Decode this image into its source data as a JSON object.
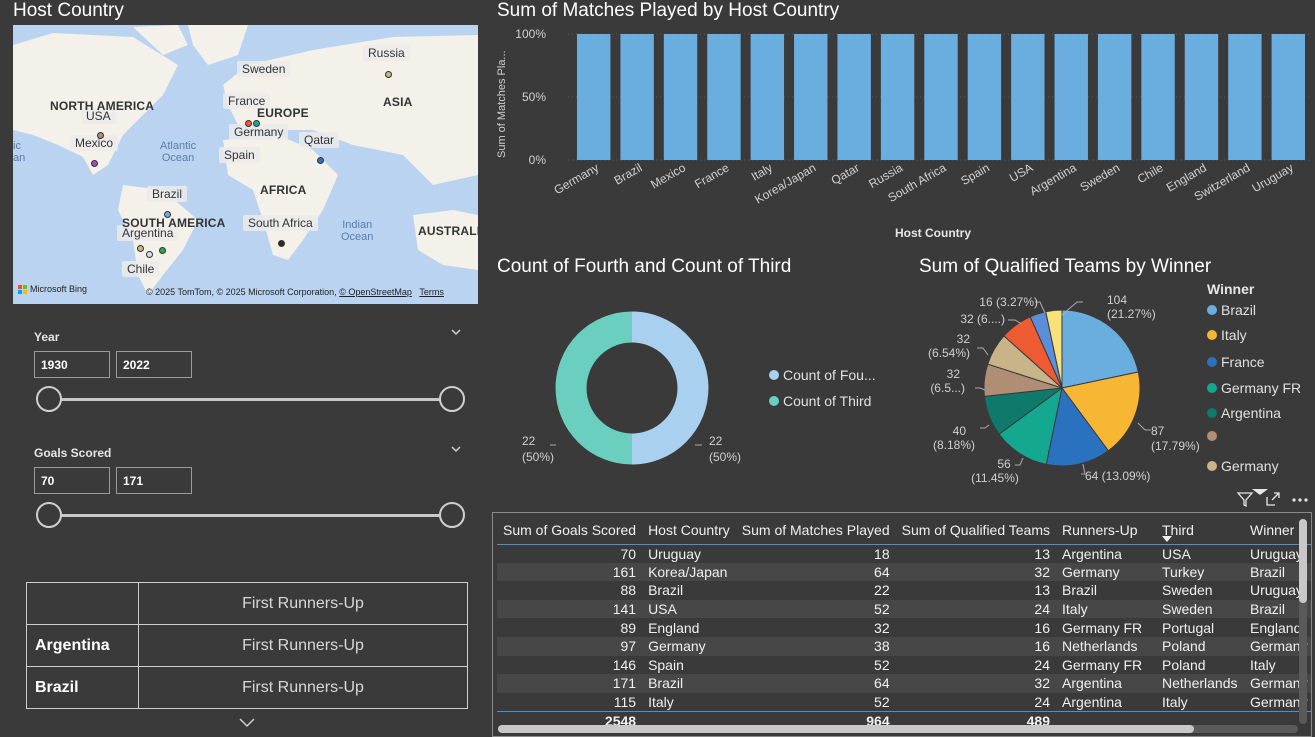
{
  "map": {
    "title": "Host Country",
    "countries": [
      "Sweden",
      "Russia",
      "France",
      "USA",
      "Germany",
      "Mexico",
      "Qatar",
      "Spain",
      "Brazil",
      "Argentina",
      "South Africa",
      "Chile"
    ],
    "regions": [
      "NORTH AMERICA",
      "EUROPE",
      "ASIA",
      "AFRICA",
      "SOUTH AMERICA",
      "AUSTRALIA"
    ],
    "oceans": [
      "Atlantic\nOcean",
      "Indian\nOcean"
    ],
    "fragment": "ic\nan",
    "bing": "Microsoft Bing",
    "credit": "© 2025 TomTom, © 2025 Microsoft Corporation,",
    "osm": "© OpenStreetMap",
    "terms": "Terms"
  },
  "year_slicer": {
    "title": "Year",
    "min": "1930",
    "max": "2022"
  },
  "goals_slicer": {
    "title": "Goals Scored",
    "min": "70",
    "max": "171"
  },
  "runners": {
    "header_value": "First Runners-Up",
    "rows": [
      {
        "name": "Argentina",
        "value": "First Runners-Up"
      },
      {
        "name": "Brazil",
        "value": "First Runners-Up"
      }
    ]
  },
  "chart_data": [
    {
      "type": "bar",
      "title": "Sum of Matches Played by Host Country",
      "xlabel": "Host Country",
      "ylabel": "Sum of Matches Pla...",
      "categories": [
        "Germany",
        "Brazil",
        "Mexico",
        "France",
        "Italy",
        "Korea/Japan",
        "Qatar",
        "Russia",
        "South Africa",
        "Spain",
        "USA",
        "Argentina",
        "Sweden",
        "Chile",
        "England",
        "Switzerland",
        "Uruguay"
      ],
      "values": [
        100,
        100,
        100,
        100,
        100,
        100,
        100,
        100,
        100,
        100,
        100,
        100,
        100,
        100,
        100,
        100,
        100
      ],
      "yticks": [
        "100%",
        "50%",
        "0%"
      ],
      "ylim": [
        0,
        100
      ],
      "color": "#6aaee0"
    },
    {
      "type": "pie",
      "title": "Count of Fourth and Count of Third",
      "series": [
        {
          "name": "Count of Fou...",
          "value": 22,
          "label": "22",
          "pct": "(50%)",
          "color": "#a9d0ee"
        },
        {
          "name": "Count of Third",
          "value": 22,
          "label": "22",
          "pct": "(50%)",
          "color": "#6acfbf"
        }
      ]
    },
    {
      "type": "pie",
      "title": "Sum of Qualified Teams by Winner",
      "legend_title": "Winner",
      "legend": [
        {
          "name": "Brazil",
          "color": "#6aaee0"
        },
        {
          "name": "Italy",
          "color": "#f7b734"
        },
        {
          "name": "France",
          "color": "#2a72c0"
        },
        {
          "name": "Germany FR",
          "color": "#14a891"
        },
        {
          "name": "Argentina",
          "color": "#0f7a6c"
        },
        {
          "name": "",
          "color": "#b08e76"
        },
        {
          "name": "Germany",
          "color": "#c8b488"
        }
      ],
      "slices": [
        {
          "value": 104,
          "label": "104",
          "pct": "(21.27%)",
          "color": "#6aaee0"
        },
        {
          "value": 87,
          "label": "87",
          "pct": "(17.79%)",
          "color": "#f7b734"
        },
        {
          "value": 64,
          "label": "64 (13.09%)",
          "pct": "",
          "color": "#2a72c0"
        },
        {
          "value": 56,
          "label": "56",
          "pct": "(11.45%)",
          "color": "#14a891"
        },
        {
          "value": 40,
          "label": "40",
          "pct": "(8.18%)",
          "color": "#0f7a6c"
        },
        {
          "value": 32,
          "label": "32",
          "pct": "(6.5...)",
          "color": "#b08e76"
        },
        {
          "value": 32,
          "label": "32",
          "pct": "(6.54%)",
          "color": "#c8b488"
        },
        {
          "value": 32,
          "label": "32 (6....)",
          "pct": "",
          "color": "#ee5a32"
        },
        {
          "value": 16,
          "label": "16 (3.27%)",
          "pct": "",
          "color": "#5a8ed8"
        },
        {
          "value": 16,
          "label": "",
          "pct": "",
          "color": "#f8e07a"
        }
      ]
    }
  ],
  "grid": {
    "columns": [
      "Sum of Goals Scored",
      "Host Country",
      "Sum of Matches Played",
      "Sum of Qualified Teams",
      "Runners-Up",
      "Third",
      "Winner"
    ],
    "rows": [
      [
        "70",
        "Uruguay",
        "18",
        "13",
        "Argentina",
        "USA",
        "Uruguay"
      ],
      [
        "161",
        "Korea/Japan",
        "64",
        "32",
        "Germany",
        "Turkey",
        "Brazil"
      ],
      [
        "88",
        "Brazil",
        "22",
        "13",
        "Brazil",
        "Sweden",
        "Uruguay"
      ],
      [
        "141",
        "USA",
        "52",
        "24",
        "Italy",
        "Sweden",
        "Brazil"
      ],
      [
        "89",
        "England",
        "32",
        "16",
        "Germany FR",
        "Portugal",
        "England"
      ],
      [
        "97",
        "Germany",
        "38",
        "16",
        "Netherlands",
        "Poland",
        "Germany"
      ],
      [
        "146",
        "Spain",
        "52",
        "24",
        "Germany FR",
        "Poland",
        "Italy"
      ],
      [
        "171",
        "Brazil",
        "64",
        "32",
        "Argentina",
        "Netherlands",
        "Germany"
      ],
      [
        "115",
        "Italy",
        "52",
        "24",
        "Argentina",
        "Italy",
        "Germany"
      ]
    ],
    "totals": [
      "2548",
      "",
      "964",
      "489",
      "",
      "",
      ""
    ]
  }
}
